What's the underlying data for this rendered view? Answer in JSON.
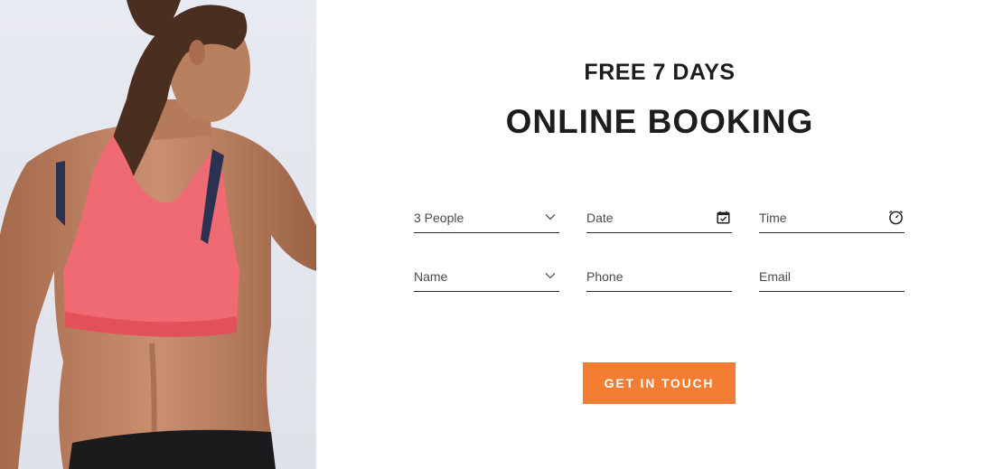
{
  "header": {
    "subtitle": "FREE 7 DAYS",
    "title": "ONLINE BOOKING"
  },
  "form": {
    "people": {
      "value": "3 People",
      "icon": "chevron-down-icon"
    },
    "date": {
      "placeholder": "Date",
      "icon": "calendar-icon"
    },
    "time": {
      "placeholder": "Time",
      "icon": "clock-icon"
    },
    "name": {
      "placeholder": "Name",
      "icon": "chevron-down-icon"
    },
    "phone": {
      "placeholder": "Phone"
    },
    "email": {
      "placeholder": "Email"
    }
  },
  "cta": {
    "label": "GET IN TOUCH",
    "color": "#f47d34"
  }
}
